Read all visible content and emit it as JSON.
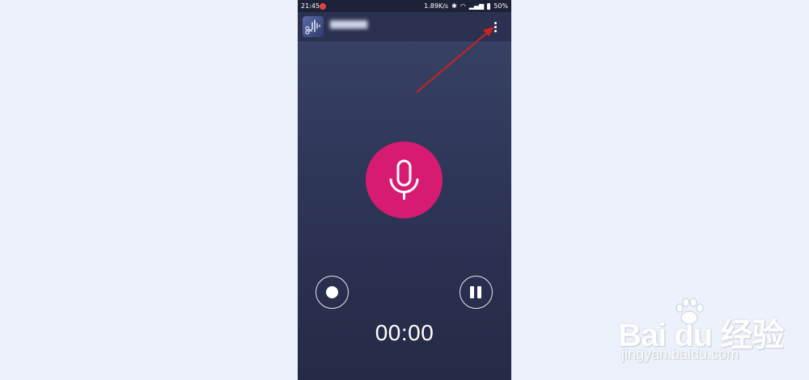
{
  "status_bar": {
    "time": "21:45",
    "network_speed": "1.89K/s",
    "battery": "50%",
    "icons": [
      "notification-icon",
      "bluetooth-icon",
      "wifi-icon",
      "signal-icon",
      "battery-icon"
    ]
  },
  "app_bar": {
    "app_icon": "audio-scissors-icon",
    "menu_icon": "more-vertical-icon"
  },
  "recorder": {
    "mic_icon": "microphone-icon",
    "record_icon": "record-icon",
    "pause_icon": "pause-icon",
    "timer": "00:00"
  },
  "annotation": {
    "arrow_color": "#d0201f"
  },
  "watermark": {
    "brand": "Bai du 经验",
    "url": "jingyan.baidu.com"
  },
  "colors": {
    "mic_button": "#d81b72",
    "background": "#2f3658"
  }
}
